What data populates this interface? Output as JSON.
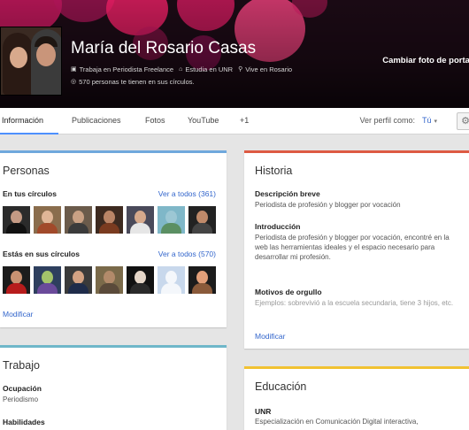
{
  "profile": {
    "name": "María del Rosario Casas",
    "work": "Trabaja en Periodista Freelance",
    "study": "Estudia en UNR",
    "lives": "Vive en Rosario",
    "circles_count_text": "570 personas te tienen en sus círculos.",
    "change_cover_label": "Cambiar foto de portada",
    "avatar_icon": "profile-photo"
  },
  "tabs": {
    "info": "Información",
    "posts": "Publicaciones",
    "photos": "Fotos",
    "youtube": "YouTube",
    "plus_one": "+1",
    "active": "Información"
  },
  "view_as": {
    "label": "Ver perfil como:",
    "value": "Tú",
    "settings_icon": "gear-icon"
  },
  "personas": {
    "title": "Personas",
    "in_your_circles": {
      "label": "En tus círculos",
      "link": "Ver a todos (361)"
    },
    "in_their_circles": {
      "label": "Estás en sus círculos",
      "link": "Ver a todos (570)"
    },
    "edit_label": "Modificar",
    "accent": "#6fa8dc"
  },
  "historia": {
    "title": "Historia",
    "tagline_label": "Descripción breve",
    "tagline_text": "Periodista de profesión y blogger por vocación",
    "intro_label": "Introducción",
    "intro_text": "Periodista de profesión y blogger por vocación, encontré en la web las herramientas ideales y el espacio necesario para desarrollar mi profesión.",
    "bragging_label": "Motivos de orgullo",
    "bragging_placeholder": "Ejemplos: sobrevivió a la escuela secundaria, tiene 3 hijos, etc.",
    "edit_label": "Modificar",
    "accent": "#dd5a43"
  },
  "trabajo": {
    "title": "Trabajo",
    "occupation_label": "Ocupación",
    "occupation_value": "Periodismo",
    "skills_label": "Habilidades",
    "accent": "#6fb7c9"
  },
  "educacion": {
    "title": "Educación",
    "school": "UNR",
    "detail": "Especialización en Comunicación Digital interactiva,",
    "accent": "#f1c232"
  }
}
